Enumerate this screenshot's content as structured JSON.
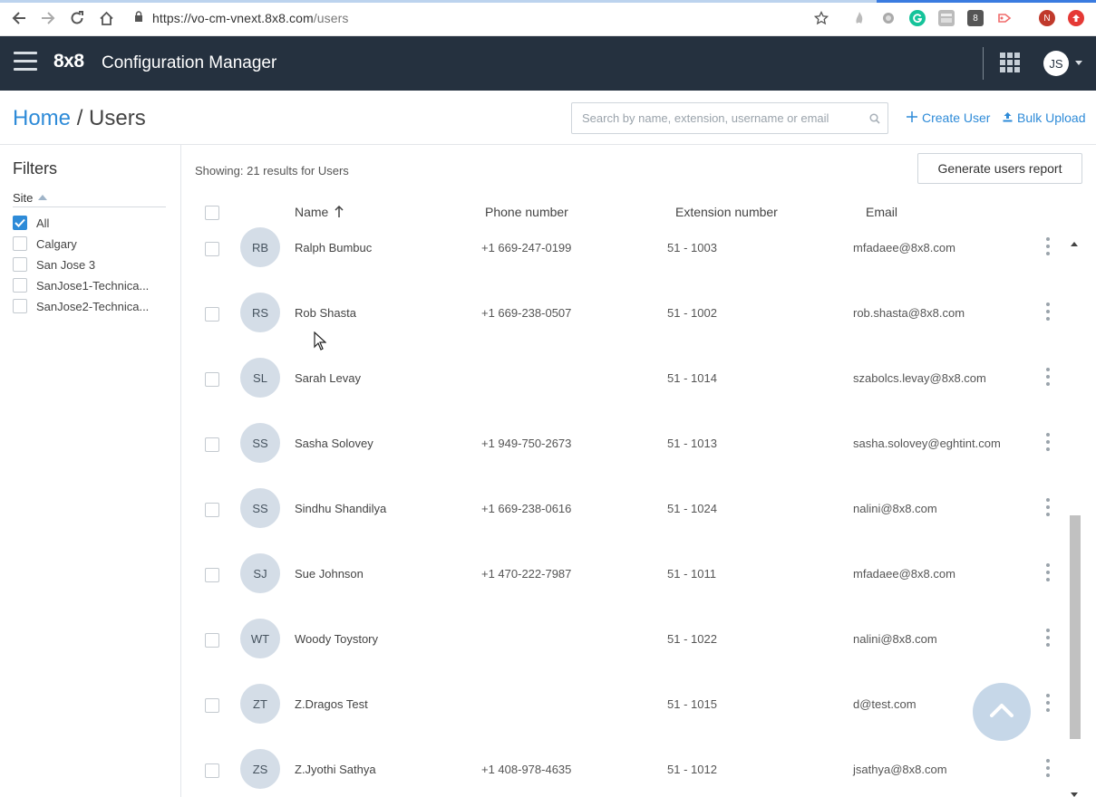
{
  "browser": {
    "url_host": "https://vo-cm-vnext.8x8.com",
    "url_path": "/users",
    "ext_8x8_label": "8",
    "profile_initial": "N"
  },
  "header": {
    "logo": "8x8",
    "title": "Configuration Manager",
    "user_initials": "JS"
  },
  "page": {
    "breadcrumb_home": "Home",
    "breadcrumb_sep": " / ",
    "breadcrumb_current": "Users",
    "search_placeholder": "Search by name, extension, username or email",
    "create_user": "Create User",
    "bulk_upload": "Bulk Upload"
  },
  "filters": {
    "title": "Filters",
    "site_label": "Site",
    "items": [
      {
        "label": "All",
        "checked": true
      },
      {
        "label": "Calgary",
        "checked": false
      },
      {
        "label": "San Jose 3",
        "checked": false
      },
      {
        "label": "SanJose1-Technica...",
        "checked": false
      },
      {
        "label": "SanJose2-Technica...",
        "checked": false
      }
    ]
  },
  "table": {
    "showing": "Showing: 21 results for Users",
    "report_button": "Generate users report",
    "headers": {
      "name": "Name",
      "phone": "Phone number",
      "extension": "Extension number",
      "email": "Email"
    },
    "rows": [
      {
        "initials": "RB",
        "name": "Ralph Bumbuc",
        "phone": "+1 669-247-0199",
        "ext": "51 - 1003",
        "email": "mfadaee@8x8.com"
      },
      {
        "initials": "RS",
        "name": "Rob Shasta",
        "phone": "+1 669-238-0507",
        "ext": "51 - 1002",
        "email": "rob.shasta@8x8.com"
      },
      {
        "initials": "SL",
        "name": "Sarah Levay",
        "phone": "",
        "ext": "51 - 1014",
        "email": "szabolcs.levay@8x8.com"
      },
      {
        "initials": "SS",
        "name": "Sasha Solovey",
        "phone": "+1 949-750-2673",
        "ext": "51 - 1013",
        "email": "sasha.solovey@eghtint.com"
      },
      {
        "initials": "SS",
        "name": "Sindhu Shandilya",
        "phone": "+1 669-238-0616",
        "ext": "51 - 1024",
        "email": "nalini@8x8.com"
      },
      {
        "initials": "SJ",
        "name": "Sue Johnson",
        "phone": "+1 470-222-7987",
        "ext": "51 - 1011",
        "email": "mfadaee@8x8.com"
      },
      {
        "initials": "WT",
        "name": "Woody Toystory",
        "phone": "",
        "ext": "51 - 1022",
        "email": "nalini@8x8.com"
      },
      {
        "initials": "ZT",
        "name": "Z.Dragos Test",
        "phone": "",
        "ext": "51 - 1015",
        "email": "d@test.com"
      },
      {
        "initials": "ZS",
        "name": "Z.Jyothi Sathya",
        "phone": "+1 408-978-4635",
        "ext": "51 - 1012",
        "email": "jsathya@8x8.com"
      }
    ]
  },
  "colors": {
    "header_bg": "#25313f",
    "accent": "#2e8bd8",
    "avatar_bg": "#d4dde7"
  }
}
